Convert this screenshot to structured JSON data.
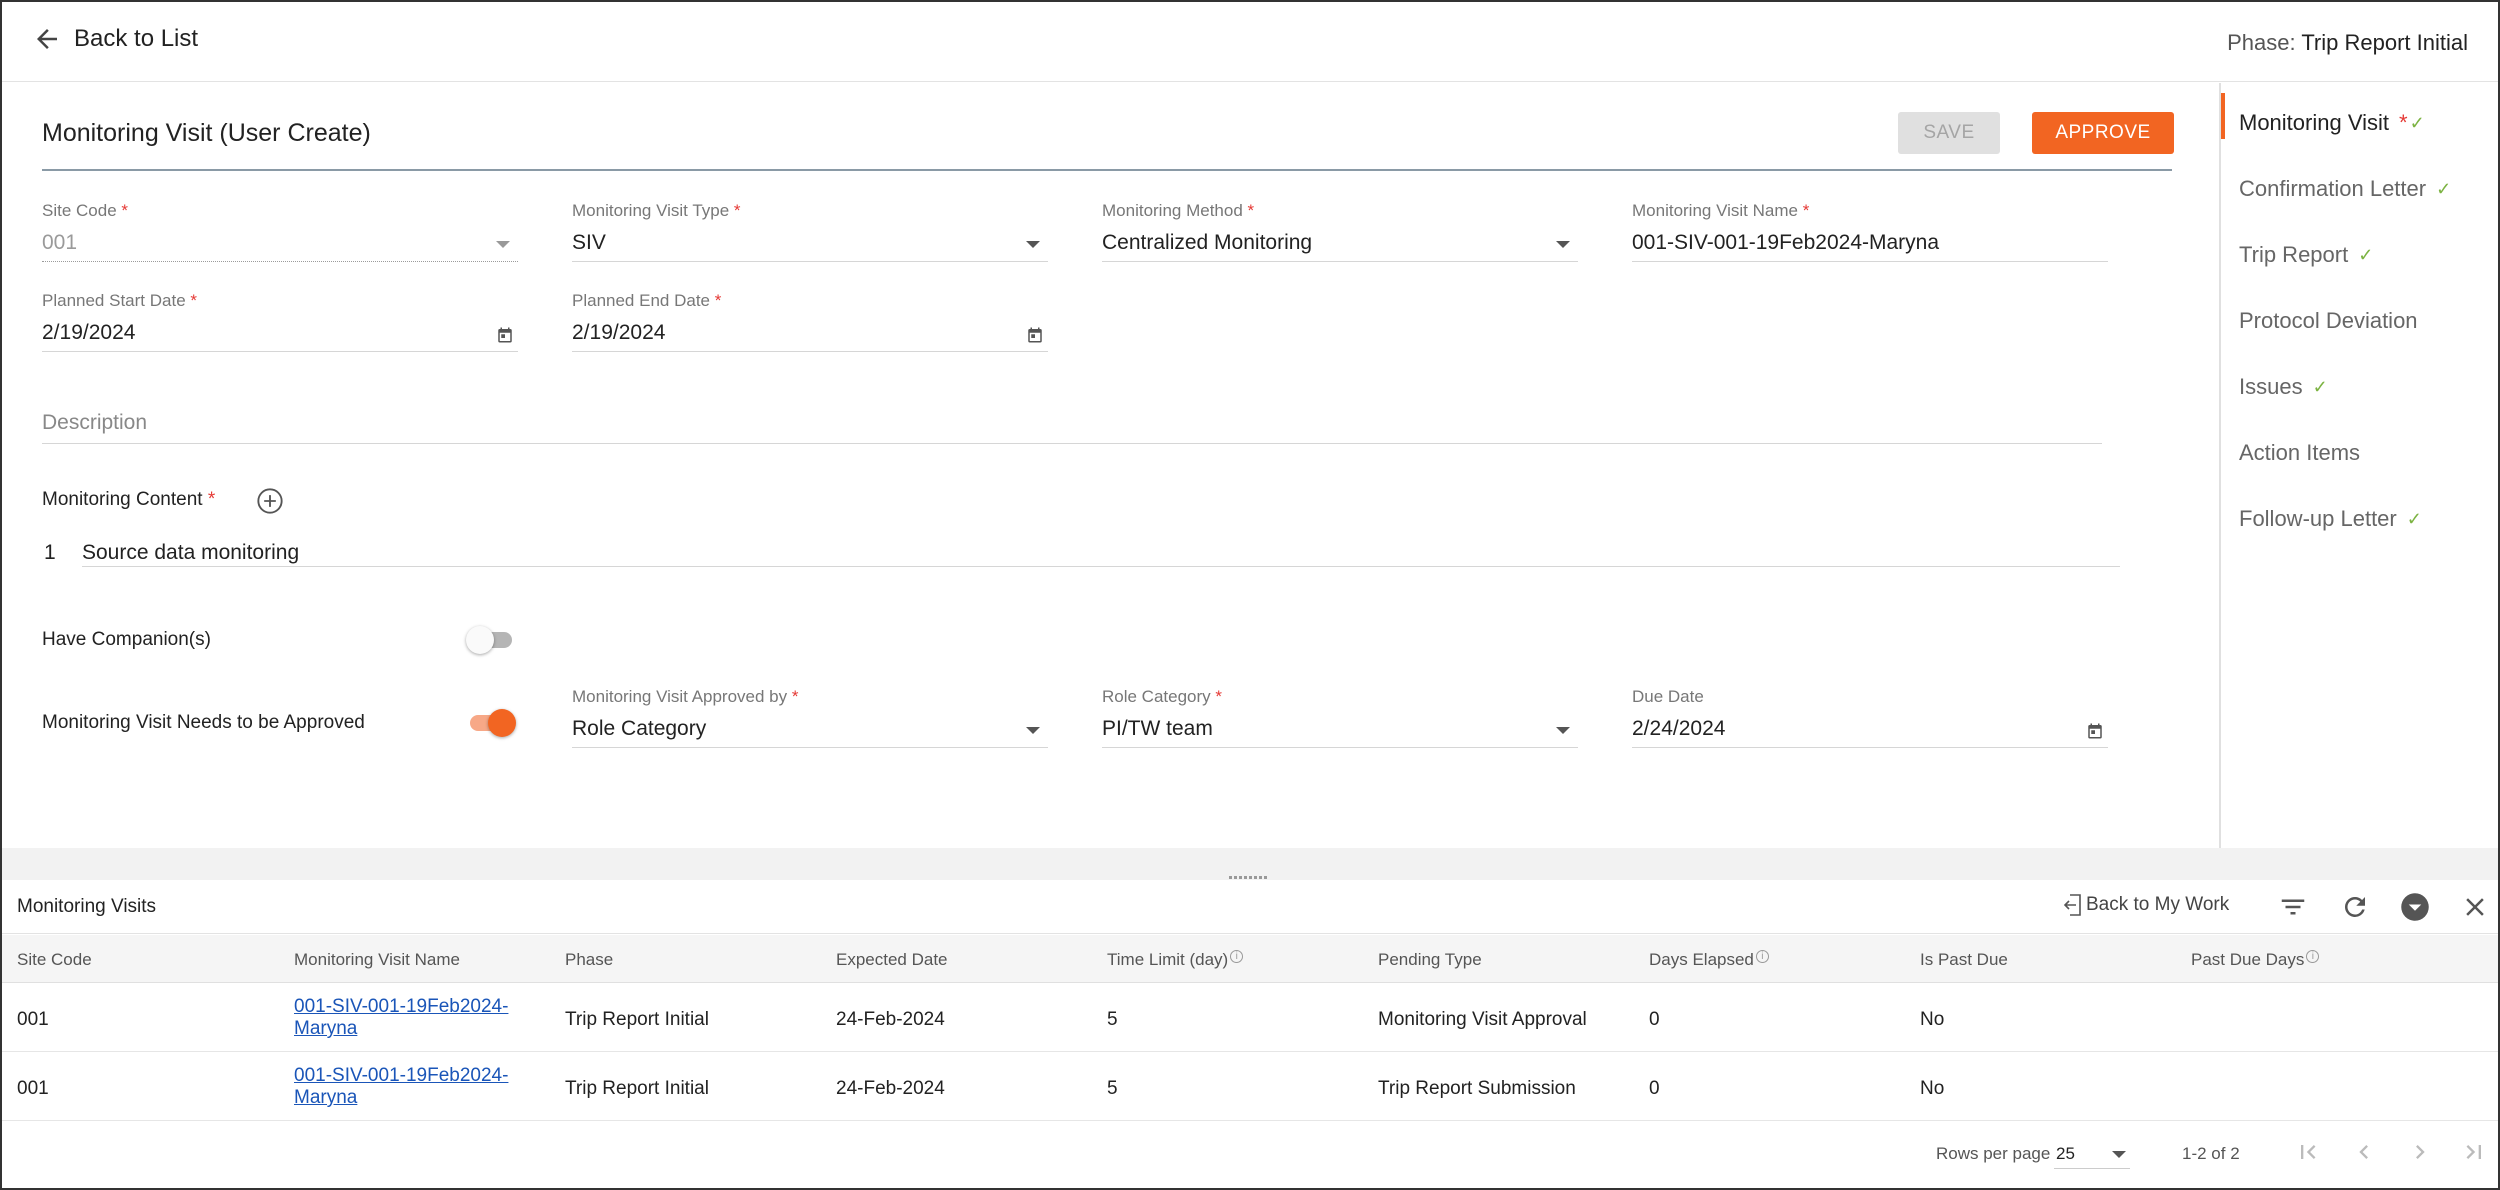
{
  "header": {
    "back_label": "Back to List",
    "phase_label": "Phase:",
    "phase_value": "Trip Report Initial"
  },
  "form": {
    "title": "Monitoring Visit (User Create)",
    "save_label": "SAVE",
    "approve_label": "APPROVE",
    "required_mark": "*",
    "site_code": {
      "label": "Site Code",
      "value": "001"
    },
    "visit_type": {
      "label": "Monitoring Visit Type",
      "value": "SIV"
    },
    "method": {
      "label": "Monitoring Method",
      "value": "Centralized Monitoring"
    },
    "visit_name": {
      "label": "Monitoring Visit Name",
      "value": "001-SIV-001-19Feb2024-Maryna"
    },
    "start_date": {
      "label": "Planned Start Date",
      "value": "2/19/2024"
    },
    "end_date": {
      "label": "Planned End Date",
      "value": "2/19/2024"
    },
    "description": {
      "label": "Description"
    },
    "monitoring_content": {
      "label": "Monitoring Content",
      "items": [
        {
          "num": "1",
          "text": "Source data monitoring"
        }
      ]
    },
    "companions": {
      "label": "Have Companion(s)",
      "on": false
    },
    "needs_approval": {
      "label": "Monitoring Visit Needs to be Approved",
      "on": true
    },
    "approved_by": {
      "label": "Monitoring Visit Approved by",
      "value": "Role Category"
    },
    "role_category": {
      "label": "Role Category",
      "value": "PI/TW team"
    },
    "due_date": {
      "label": "Due Date",
      "value": "2/24/2024"
    }
  },
  "nav": {
    "items": [
      {
        "label": "Monitoring Visit",
        "star": "*",
        "check": "✓",
        "active": true
      },
      {
        "label": "Confirmation Letter",
        "check": "✓"
      },
      {
        "label": "Trip Report",
        "check": "✓"
      },
      {
        "label": "Protocol Deviation",
        "check": ""
      },
      {
        "label": "Issues",
        "check": "✓"
      },
      {
        "label": "Action Items",
        "check": ""
      },
      {
        "label": "Follow-up Letter",
        "check": "✓"
      }
    ]
  },
  "panel": {
    "title": "Monitoring Visits",
    "back_to_work": "Back to My Work",
    "columns": [
      "Site Code",
      "Monitoring Visit Name",
      "Phase",
      "Expected Date",
      "Time Limit (day)",
      "Pending Type",
      "Days Elapsed",
      "Is Past Due",
      "Past Due Days"
    ],
    "rows": [
      {
        "site": "001",
        "name_line1": "001-SIV-001-19Feb2024-",
        "name_line2": "Maryna",
        "phase": "Trip Report Initial",
        "expected": "24-Feb-2024",
        "limit": "5",
        "pending": "Monitoring Visit Approval",
        "elapsed": "0",
        "past_due": "No",
        "past_due_days": ""
      },
      {
        "site": "001",
        "name_line1": "001-SIV-001-19Feb2024-",
        "name_line2": "Maryna",
        "phase": "Trip Report Initial",
        "expected": "24-Feb-2024",
        "limit": "5",
        "pending": "Trip Report Submission",
        "elapsed": "0",
        "past_due": "No",
        "past_due_days": ""
      }
    ],
    "rows_per_page_label": "Rows per page",
    "rows_per_page": "25",
    "range": "1-2 of 2"
  },
  "colors": {
    "accent": "#f26522",
    "check": "#7cb342",
    "required": "#e53935",
    "link": "#1a55b8"
  }
}
